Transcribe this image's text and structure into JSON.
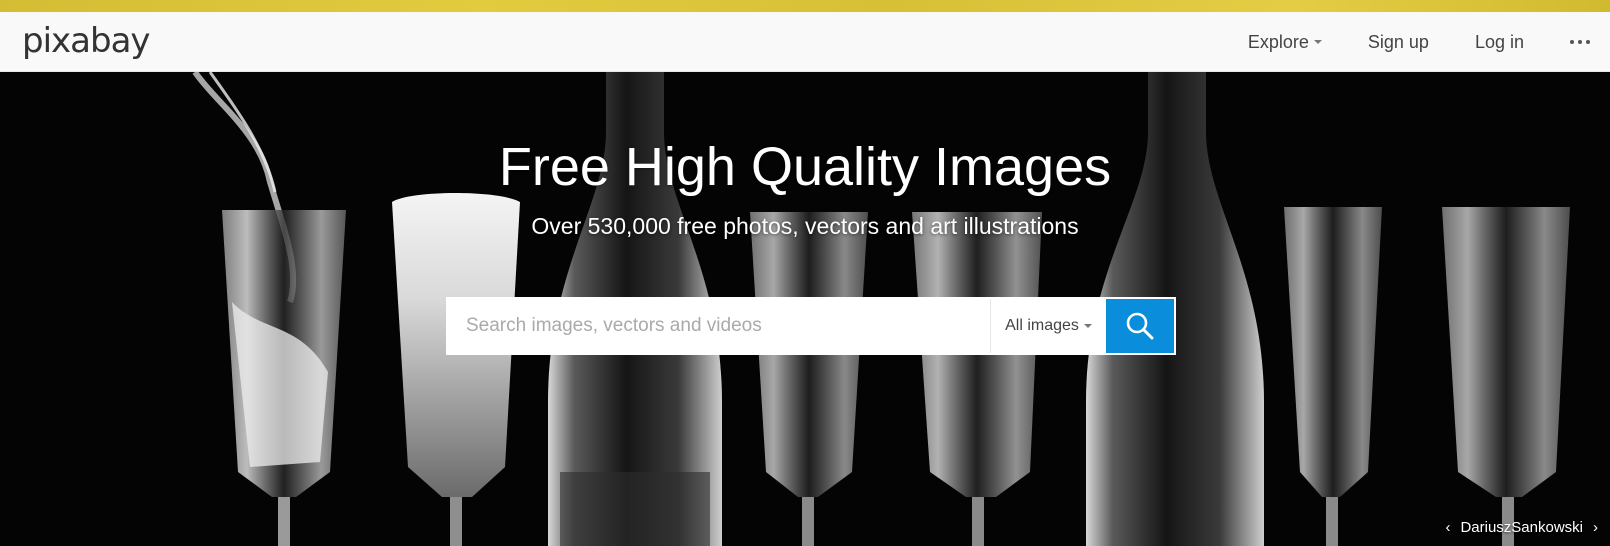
{
  "brand": {
    "logo_text": "pixabay",
    "accent_color": "#0a8ddb",
    "top_strip_color": "#dcc53a"
  },
  "nav": {
    "explore_label": "Explore",
    "signup_label": "Sign up",
    "login_label": "Log in",
    "more_icon": "more-horizontal-icon"
  },
  "hero": {
    "title": "Free High Quality Images",
    "subtitle": "Over 530,000 free photos, vectors and art illustrations",
    "background": "champagne glasses and bottles on black"
  },
  "search": {
    "placeholder": "Search images, vectors and videos",
    "value": "",
    "type_selected": "All images",
    "button_icon": "search-icon"
  },
  "credit": {
    "author": "DariuszSankowski",
    "prev_label": "‹",
    "next_label": "›"
  }
}
